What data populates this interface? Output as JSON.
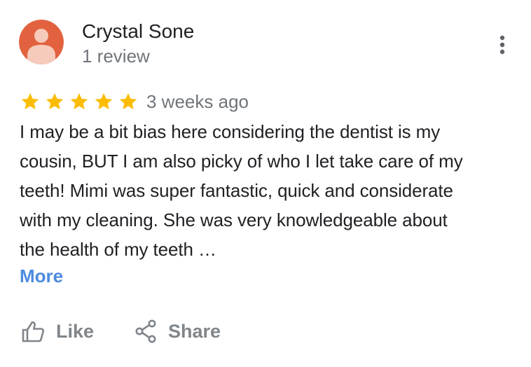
{
  "reviewer": {
    "name": "Crystal Sone",
    "review_count": "1 review",
    "avatar_icon": "person-avatar-icon",
    "avatar_color": "#e2623f"
  },
  "menu": {
    "icon": "more-vert-icon"
  },
  "rating": {
    "stars": 5,
    "max_stars": 5,
    "star_color": "#fbbc04"
  },
  "review": {
    "date": "3 weeks ago",
    "text_lines": [
      "I may be a bit bias here considering the dentist is my",
      "cousin, BUT I am also picky of who I let take care of my",
      "teeth! Mimi was super fantastic, quick and considerate",
      "with my cleaning. She was very knowledgeable about",
      "the health of my teeth …"
    ],
    "more_label": "More"
  },
  "actions": {
    "like_label": "Like",
    "like_icon": "thumb-up-icon",
    "share_label": "Share",
    "share_icon": "share-icon"
  },
  "colors": {
    "primary_text": "#202124",
    "secondary_text": "#70757a",
    "link": "#4c8ae0",
    "action_text": "#80868b"
  }
}
